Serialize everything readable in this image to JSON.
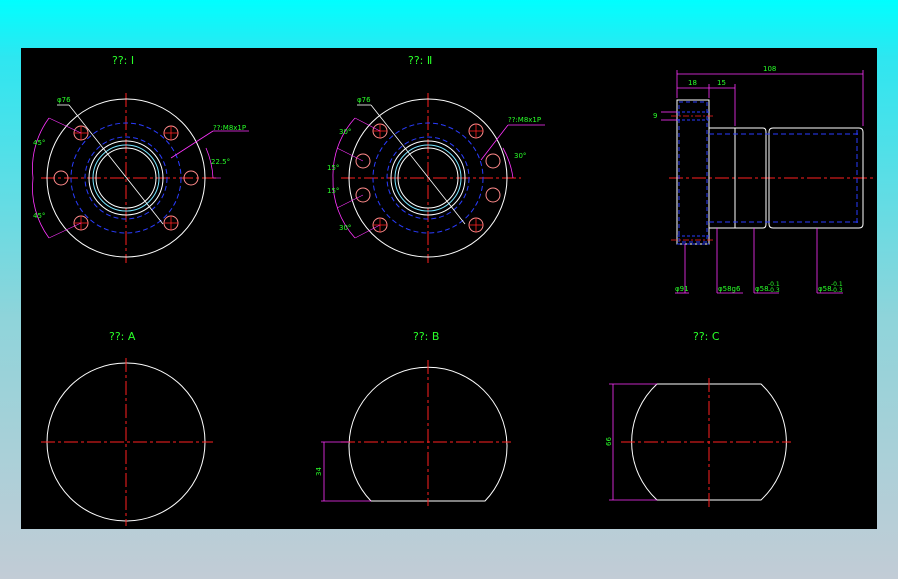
{
  "titles": {
    "type_1": "??: Ⅰ",
    "type_2": "??: Ⅱ",
    "type_a": "??: A",
    "type_b": "??: B",
    "type_c": "??: C"
  },
  "type_1": {
    "dia_label": "φ76",
    "thread_label": "??:M8x1P",
    "angle_top": "45°",
    "angle_bottom": "45°",
    "angle_right": "22.5°"
  },
  "type_2": {
    "dia_label": "φ76",
    "thread_label": "??:M8x1P",
    "angle_top": "30°",
    "angle_mid_top": "15°",
    "angle_mid_bottom": "15°",
    "angle_bottom": "30°",
    "angle_right": "30°"
  },
  "side_view": {
    "dim_total": "108",
    "dim_flange": "18",
    "dim_step": "15",
    "dim_hole": "9",
    "dia_flange": "φ91",
    "dia_spigot": "φ58g6",
    "dia_body1": "φ58",
    "dia_body1_tol": "-0.1\n-0.3",
    "dia_body2": "φ58",
    "dia_body2_tol": "-0.1\n-0.3"
  },
  "cut_b": {
    "dim": "34"
  },
  "cut_c": {
    "dim": "66"
  },
  "colors": {
    "background": "#000000",
    "outline": "#ffffff",
    "centerline": "#ff2020",
    "hidden": "#2a3cff",
    "dimension": "#ff33ff",
    "text": "#29ff29",
    "bolt_hole": "#ff8a8a",
    "bore_ring": "#79e6ff"
  }
}
